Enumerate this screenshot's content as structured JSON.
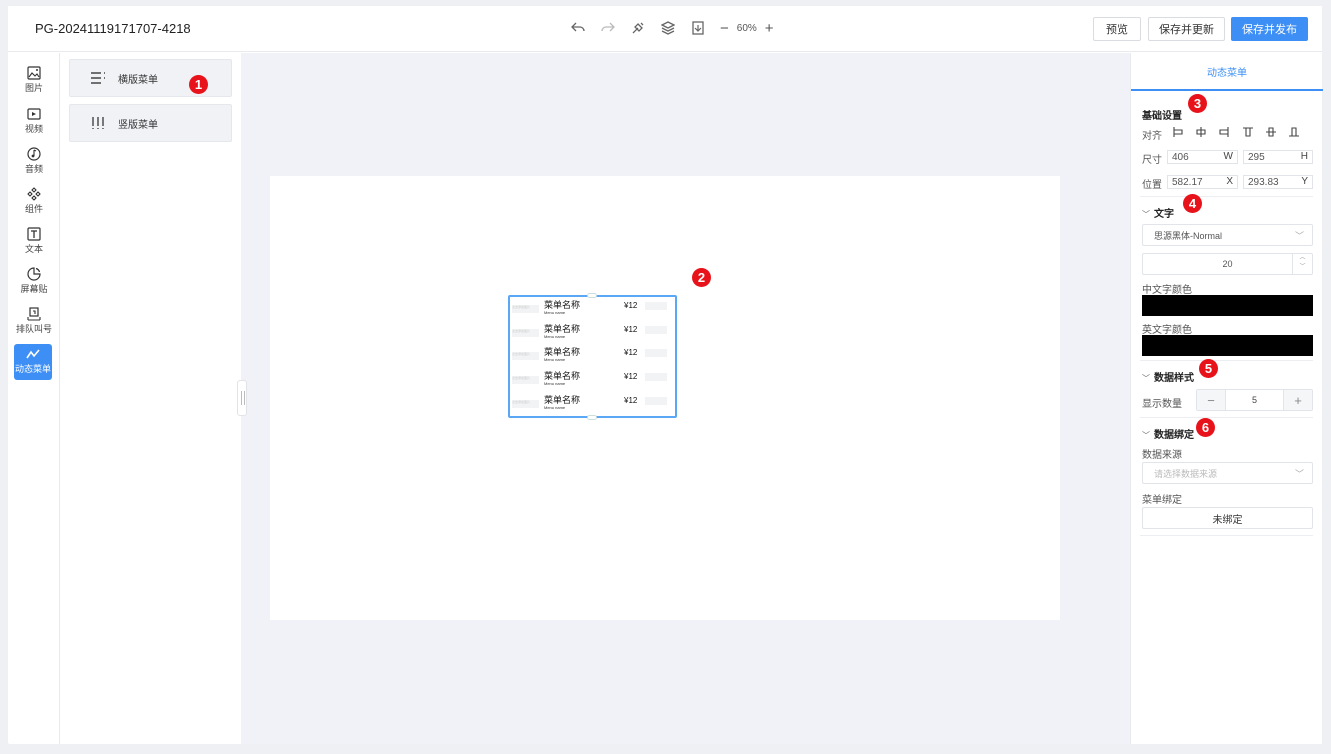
{
  "header": {
    "title": "PG-20241119171707-4218",
    "zoom": "60%",
    "preview_label": "预览",
    "save_update_label": "保存并更新",
    "save_publish_label": "保存并发布"
  },
  "rail": {
    "items": [
      {
        "label": "图片",
        "icon": "image-icon"
      },
      {
        "label": "视频",
        "icon": "video-icon"
      },
      {
        "label": "音频",
        "icon": "audio-icon"
      },
      {
        "label": "组件",
        "icon": "component-icon"
      },
      {
        "label": "文本",
        "icon": "text-icon"
      },
      {
        "label": "屏幕贴",
        "icon": "sticker-icon"
      },
      {
        "label": "排队叫号",
        "icon": "queue-icon"
      },
      {
        "label": "动态菜单",
        "icon": "dynamic-menu-icon",
        "active": true
      }
    ]
  },
  "menu_types": {
    "horizontal": "横版菜单",
    "vertical": "竖版菜单"
  },
  "widget": {
    "rows": [
      {
        "img": "点击添加图片",
        "name": "菜单名称",
        "en": "Menu name",
        "price": "¥12"
      },
      {
        "img": "点击添加图片",
        "name": "菜单名称",
        "en": "Menu name",
        "price": "¥12"
      },
      {
        "img": "点击添加图片",
        "name": "菜单名称",
        "en": "Menu name",
        "price": "¥12"
      },
      {
        "img": "点击添加图片",
        "name": "菜单名称",
        "en": "Menu name",
        "price": "¥12"
      },
      {
        "img": "点击添加图片",
        "name": "菜单名称",
        "en": "Menu name",
        "price": "¥12"
      }
    ]
  },
  "badges": [
    "1",
    "2",
    "3",
    "4",
    "5",
    "6"
  ],
  "props": {
    "tab": "动态菜单",
    "basic": {
      "title": "基础设置",
      "align_label": "对齐",
      "size_label": "尺寸",
      "width": "406",
      "width_unit": "W",
      "height": "295",
      "height_unit": "H",
      "pos_label": "位置",
      "x": "582.17",
      "x_unit": "X",
      "y": "293.83",
      "y_unit": "Y"
    },
    "text": {
      "title": "文字",
      "font": "思源黑体-Normal",
      "font_size": "20",
      "cn_color_label": "中文字颜色",
      "cn_color": "#000000",
      "en_color_label": "英文字颜色",
      "en_color": "#000000"
    },
    "data_style": {
      "title": "数据样式",
      "count_label": "显示数量",
      "count": "5",
      "minus": "−",
      "plus": "+"
    },
    "binding": {
      "title": "数据绑定",
      "source_label": "数据来源",
      "source_placeholder": "请选择数据来源",
      "menu_bind_label": "菜单绑定",
      "menu_bind_value": "未绑定"
    }
  }
}
